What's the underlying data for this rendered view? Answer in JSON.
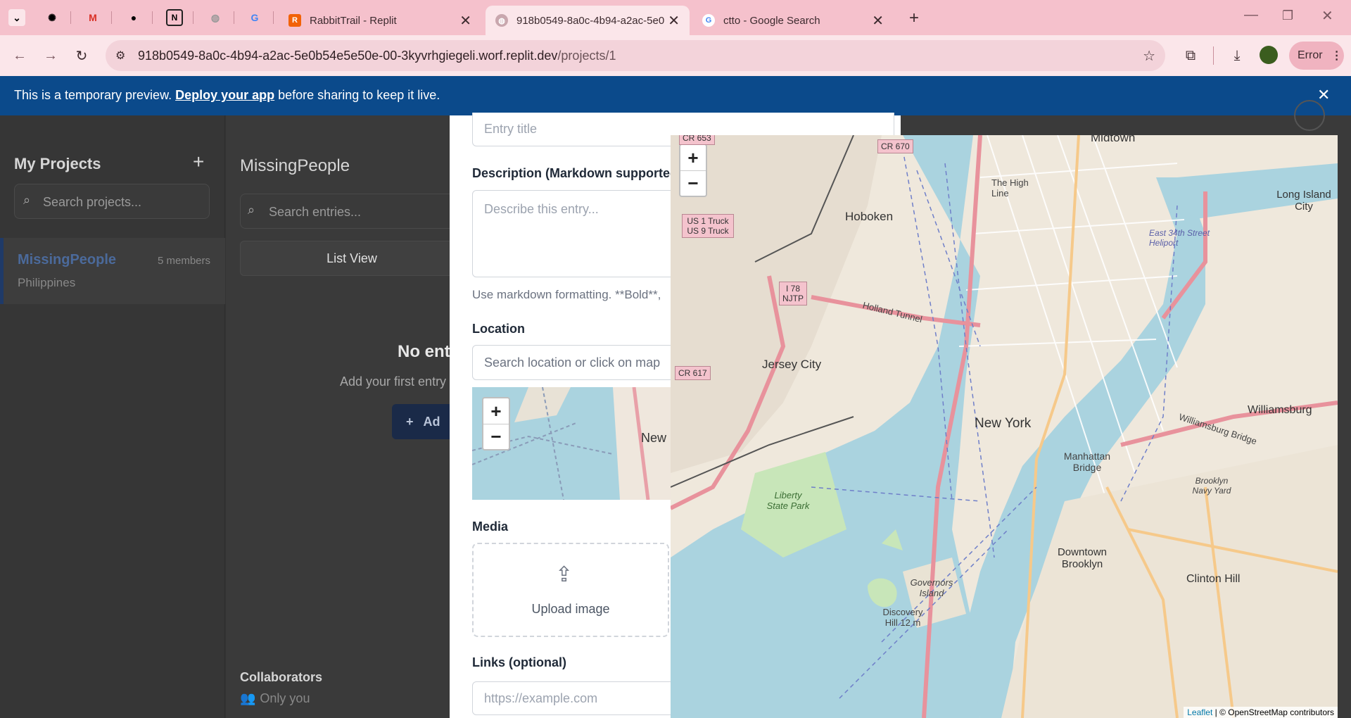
{
  "browser": {
    "tabs": [
      {
        "title": "RabbitTrail - Replit"
      },
      {
        "title": "918b0549-8a0c-4b94-a2ac-5e0"
      },
      {
        "title": "ctto - Google Search"
      }
    ],
    "url_host": "918b0549-8a0c-4b94-a2ac-5e0b54e5e50e-00-3kyvrhgiegeli.worf.replit.dev",
    "url_path": "/projects/1",
    "profile_label": "Error"
  },
  "banner": {
    "text_before": "This is a temporary preview.",
    "link": "Deploy your app",
    "text_after": "before sharing to keep it live."
  },
  "sidebar": {
    "title": "My Projects",
    "search_placeholder": "Search projects...",
    "project": {
      "name": "MissingPeople",
      "members": "5 members",
      "location": "Philippines"
    }
  },
  "main": {
    "title": "MissingPeople",
    "search_placeholder": "Search entries...",
    "list_view": "List View",
    "empty_title": "No entr",
    "empty_sub": "Add your first entry",
    "add_button": "Ad",
    "collaborators_title": "Collaborators",
    "collaborators_value": "Only you"
  },
  "modal": {
    "title_placeholder": "Entry title",
    "description_label": "Description (Markdown supported)",
    "description_placeholder": "Describe this entry...",
    "markdown_hint": "Use markdown formatting. **Bold**,",
    "location_label": "Location",
    "location_placeholder": "Search location or click on map",
    "small_map_label": "New",
    "media_label": "Media",
    "upload_label": "Upload image",
    "links_label": "Links (optional)",
    "links_placeholder": "https://example.com"
  },
  "map": {
    "zoom_in": "+",
    "zoom_out": "−",
    "labels": {
      "midtown": "Midtown",
      "hoboken": "Hoboken",
      "high_line": "The High Line",
      "long_island_city": "Long Island City",
      "east_34th": "East 34th Street Heliport",
      "jersey_city": "Jersey City",
      "new_york": "New York",
      "williamsburg": "Williamsburg",
      "manhattan_bridge": "Manhattan Bridge",
      "brooklyn_navy_yard": "Brooklyn Navy Yard",
      "liberty_state_park": "Liberty State Park",
      "downtown_brooklyn": "Downtown Brooklyn",
      "clinton_hill": "Clinton Hill",
      "governors_island": "Governors Island",
      "discovery_hill": "Discovery Hill 12 m",
      "holland_tunnel": "Holland Tunnel",
      "williamsburg_bridge": "Williamsburg Bridge"
    },
    "shields": {
      "cr670": "CR 670",
      "cr653": "CR 653",
      "us1": "US 1 Truck",
      "us9": "US 9 Truck",
      "i78": "I 78",
      "njtp": "NJTP",
      "cr617": "CR 617"
    },
    "attribution_link": "Leaflet",
    "attribution_text": "| © OpenStreetMap contributors"
  },
  "colors": {
    "banner": "#0b4a8b",
    "tabbar": "#f5c1cc",
    "water": "#aad3df"
  }
}
